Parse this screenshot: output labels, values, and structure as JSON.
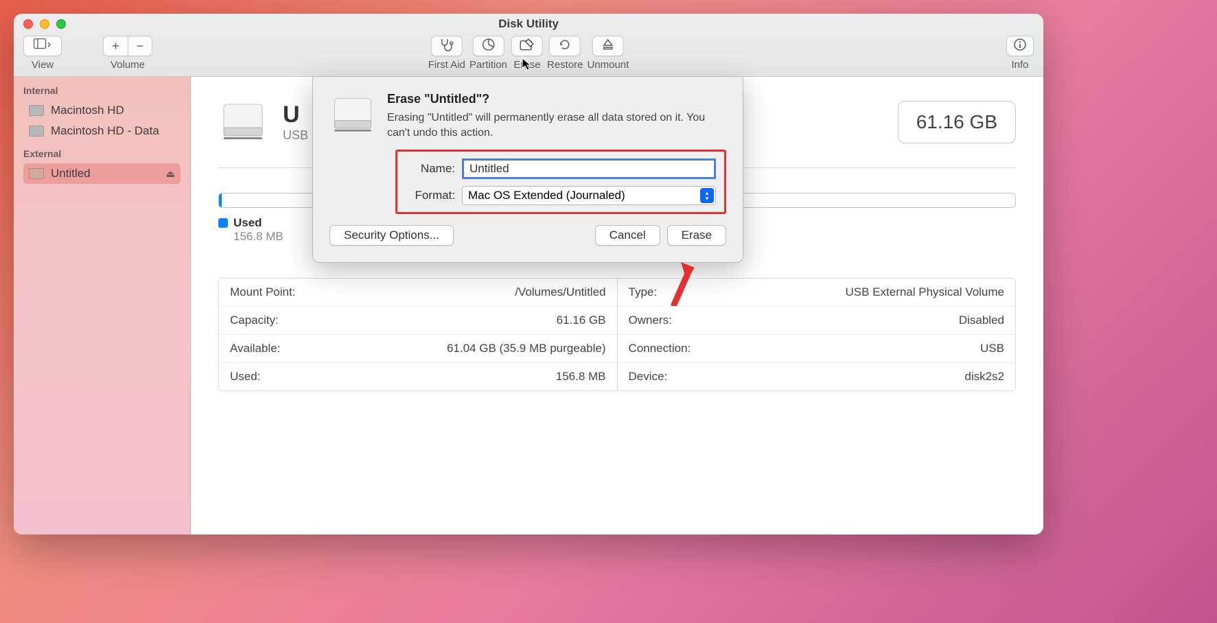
{
  "window": {
    "title": "Disk Utility"
  },
  "toolbar": {
    "view_label": "View",
    "volume_label": "Volume",
    "first_aid_label": "First Aid",
    "partition_label": "Partition",
    "erase_label": "Erase",
    "restore_label": "Restore",
    "unmount_label": "Unmount",
    "info_label": "Info"
  },
  "sidebar": {
    "internal_header": "Internal",
    "external_header": "External",
    "internal_items": [
      "Macintosh HD",
      "Macintosh HD - Data"
    ],
    "external_items": [
      "Untitled"
    ]
  },
  "volume": {
    "name_partial": "U",
    "subtitle_partial": "USB",
    "size": "61.16 GB",
    "used_label": "Used",
    "used_value": "156.8 MB"
  },
  "details": {
    "left": [
      {
        "label": "Mount Point:",
        "value": "/Volumes/Untitled"
      },
      {
        "label": "Capacity:",
        "value": "61.16 GB"
      },
      {
        "label": "Available:",
        "value": "61.04 GB (35.9 MB purgeable)"
      },
      {
        "label": "Used:",
        "value": "156.8 MB"
      }
    ],
    "right": [
      {
        "label": "Type:",
        "value": "USB External Physical Volume"
      },
      {
        "label": "Owners:",
        "value": "Disabled"
      },
      {
        "label": "Connection:",
        "value": "USB"
      },
      {
        "label": "Device:",
        "value": "disk2s2"
      }
    ]
  },
  "sheet": {
    "title": "Erase \"Untitled\"?",
    "description": "Erasing \"Untitled\" will permanently erase all data stored on it. You can't undo this action.",
    "name_label": "Name:",
    "name_value": "Untitled",
    "format_label": "Format:",
    "format_value": "Mac OS Extended (Journaled)",
    "security_btn": "Security Options...",
    "cancel_btn": "Cancel",
    "erase_btn": "Erase"
  }
}
